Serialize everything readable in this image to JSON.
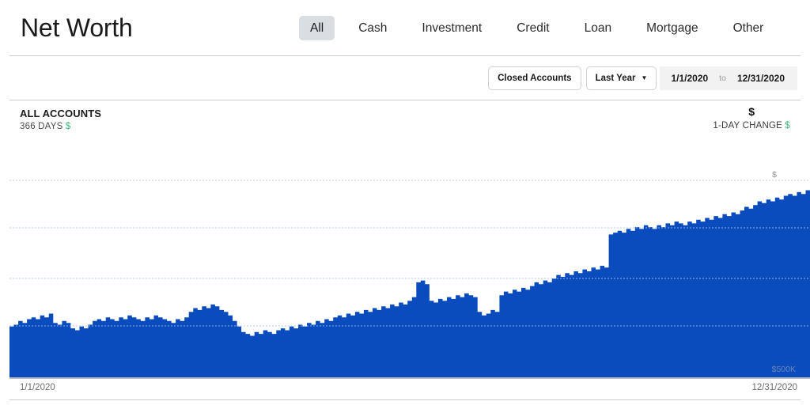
{
  "header": {
    "title": "Net Worth",
    "tabs": [
      {
        "label": "All",
        "active": true
      },
      {
        "label": "Cash",
        "active": false
      },
      {
        "label": "Investment",
        "active": false
      },
      {
        "label": "Credit",
        "active": false
      },
      {
        "label": "Loan",
        "active": false
      },
      {
        "label": "Mortgage",
        "active": false
      },
      {
        "label": "Other",
        "active": false
      }
    ]
  },
  "filters": {
    "closed_accounts_label": "Closed Accounts",
    "range_preset_label": "Last Year",
    "caret_icon": "chevron-down-icon",
    "date_from": "1/1/2020",
    "date_to_separator": "to",
    "date_to": "12/31/2020"
  },
  "summary": {
    "account_scope": "ALL ACCOUNTS",
    "period_label": "366 DAYS",
    "period_value": "$",
    "total_value": "$",
    "change_label": "1-DAY CHANGE",
    "change_value": "$"
  },
  "colors": {
    "area_fill": "#0a4bbd",
    "tab_active_bg": "#d9dee2",
    "positive": "#3cb878",
    "gridline": "#c8ccd0",
    "daterange_bg": "#f2f2f2"
  },
  "chart_data": {
    "type": "area",
    "title": "Net Worth",
    "xlabel": "",
    "ylabel": "",
    "grid": true,
    "legend_position": "none",
    "x_tick_labels": [
      "1/1/2020",
      "12/31/2020"
    ],
    "axis_annotations": [
      {
        "text": "$",
        "position": "top-right-gridline"
      },
      {
        "text": "$500K",
        "position": "bottom-right-gridline"
      }
    ],
    "x_start": "1/1/2020",
    "x_end": "12/31/2020",
    "points": [
      [
        0,
        28
      ],
      [
        2,
        29
      ],
      [
        4,
        31
      ],
      [
        6,
        30
      ],
      [
        8,
        32
      ],
      [
        10,
        33
      ],
      [
        12,
        32
      ],
      [
        14,
        34
      ],
      [
        16,
        33
      ],
      [
        18,
        35
      ],
      [
        20,
        30
      ],
      [
        22,
        29
      ],
      [
        24,
        31
      ],
      [
        26,
        30
      ],
      [
        28,
        27
      ],
      [
        30,
        26
      ],
      [
        32,
        28
      ],
      [
        34,
        27
      ],
      [
        36,
        29
      ],
      [
        38,
        31
      ],
      [
        40,
        32
      ],
      [
        42,
        31
      ],
      [
        44,
        33
      ],
      [
        46,
        32
      ],
      [
        48,
        31
      ],
      [
        50,
        33
      ],
      [
        52,
        32
      ],
      [
        54,
        34
      ],
      [
        56,
        33
      ],
      [
        58,
        32
      ],
      [
        60,
        31
      ],
      [
        62,
        33
      ],
      [
        64,
        32
      ],
      [
        66,
        34
      ],
      [
        68,
        33
      ],
      [
        70,
        32
      ],
      [
        72,
        31
      ],
      [
        74,
        30
      ],
      [
        76,
        32
      ],
      [
        78,
        31
      ],
      [
        80,
        33
      ],
      [
        82,
        36
      ],
      [
        84,
        38
      ],
      [
        86,
        37
      ],
      [
        88,
        39
      ],
      [
        90,
        38
      ],
      [
        92,
        40
      ],
      [
        94,
        39
      ],
      [
        96,
        37
      ],
      [
        98,
        36
      ],
      [
        100,
        34
      ],
      [
        102,
        31
      ],
      [
        104,
        28
      ],
      [
        106,
        25
      ],
      [
        108,
        24
      ],
      [
        110,
        23
      ],
      [
        112,
        25
      ],
      [
        114,
        24
      ],
      [
        116,
        26
      ],
      [
        118,
        25
      ],
      [
        120,
        24
      ],
      [
        122,
        26
      ],
      [
        124,
        27
      ],
      [
        126,
        26
      ],
      [
        128,
        28
      ],
      [
        130,
        27
      ],
      [
        132,
        29
      ],
      [
        134,
        28
      ],
      [
        136,
        30
      ],
      [
        138,
        29
      ],
      [
        140,
        31
      ],
      [
        142,
        30
      ],
      [
        144,
        32
      ],
      [
        146,
        31
      ],
      [
        148,
        33
      ],
      [
        150,
        34
      ],
      [
        152,
        33
      ],
      [
        154,
        35
      ],
      [
        156,
        34
      ],
      [
        158,
        36
      ],
      [
        160,
        35
      ],
      [
        162,
        37
      ],
      [
        164,
        36
      ],
      [
        166,
        38
      ],
      [
        168,
        37
      ],
      [
        170,
        39
      ],
      [
        172,
        38
      ],
      [
        174,
        40
      ],
      [
        176,
        39
      ],
      [
        178,
        41
      ],
      [
        180,
        40
      ],
      [
        182,
        42
      ],
      [
        184,
        44
      ],
      [
        186,
        52
      ],
      [
        188,
        53
      ],
      [
        190,
        51
      ],
      [
        192,
        42
      ],
      [
        194,
        41
      ],
      [
        196,
        43
      ],
      [
        198,
        42
      ],
      [
        200,
        44
      ],
      [
        202,
        43
      ],
      [
        204,
        45
      ],
      [
        206,
        44
      ],
      [
        208,
        46
      ],
      [
        210,
        45
      ],
      [
        212,
        44
      ],
      [
        214,
        36
      ],
      [
        216,
        34
      ],
      [
        218,
        35
      ],
      [
        220,
        37
      ],
      [
        222,
        36
      ],
      [
        224,
        45
      ],
      [
        226,
        47
      ],
      [
        228,
        46
      ],
      [
        230,
        48
      ],
      [
        232,
        47
      ],
      [
        234,
        49
      ],
      [
        236,
        48
      ],
      [
        238,
        50
      ],
      [
        240,
        52
      ],
      [
        242,
        51
      ],
      [
        244,
        53
      ],
      [
        246,
        52
      ],
      [
        248,
        54
      ],
      [
        250,
        56
      ],
      [
        252,
        55
      ],
      [
        254,
        57
      ],
      [
        256,
        56
      ],
      [
        258,
        58
      ],
      [
        260,
        57
      ],
      [
        262,
        59
      ],
      [
        264,
        58
      ],
      [
        266,
        60
      ],
      [
        268,
        59
      ],
      [
        270,
        61
      ],
      [
        272,
        60
      ],
      [
        274,
        78
      ],
      [
        276,
        79
      ],
      [
        278,
        80
      ],
      [
        280,
        79
      ],
      [
        282,
        81
      ],
      [
        284,
        80
      ],
      [
        286,
        82
      ],
      [
        288,
        81
      ],
      [
        290,
        83
      ],
      [
        292,
        82
      ],
      [
        294,
        81
      ],
      [
        296,
        83
      ],
      [
        298,
        82
      ],
      [
        300,
        84
      ],
      [
        302,
        83
      ],
      [
        304,
        85
      ],
      [
        306,
        84
      ],
      [
        308,
        83
      ],
      [
        310,
        85
      ],
      [
        312,
        84
      ],
      [
        314,
        86
      ],
      [
        316,
        85
      ],
      [
        318,
        87
      ],
      [
        320,
        86
      ],
      [
        322,
        88
      ],
      [
        324,
        87
      ],
      [
        326,
        89
      ],
      [
        328,
        88
      ],
      [
        330,
        90
      ],
      [
        332,
        89
      ],
      [
        334,
        91
      ],
      [
        336,
        93
      ],
      [
        338,
        92
      ],
      [
        340,
        94
      ],
      [
        342,
        96
      ],
      [
        344,
        95
      ],
      [
        346,
        97
      ],
      [
        348,
        96
      ],
      [
        350,
        98
      ],
      [
        352,
        97
      ],
      [
        354,
        99
      ],
      [
        356,
        100
      ],
      [
        358,
        99
      ],
      [
        360,
        101
      ],
      [
        362,
        100
      ],
      [
        364,
        102
      ],
      [
        366,
        103
      ]
    ]
  }
}
